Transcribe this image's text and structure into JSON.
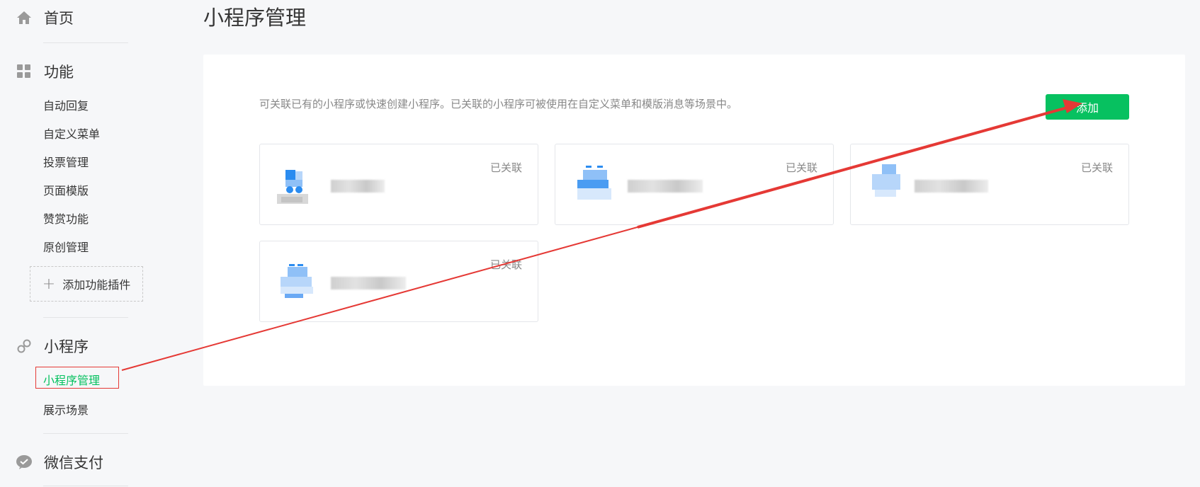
{
  "sidebar": {
    "home": {
      "label": "首页",
      "icon": "home-icon"
    },
    "features": {
      "label": "功能",
      "icon": "grid-icon",
      "items": [
        "自动回复",
        "自定义菜单",
        "投票管理",
        "页面模版",
        "赞赏功能",
        "原创管理"
      ],
      "add_plugin_label": "添加功能插件"
    },
    "miniprogram": {
      "label": "小程序",
      "icon": "link-icon",
      "items": [
        "小程序管理",
        "展示场景"
      ]
    },
    "wechat_pay": {
      "label": "微信支付",
      "icon": "wechat-pay-icon"
    }
  },
  "main": {
    "title": "小程序管理",
    "description": "可关联已有的小程序或快速创建小程序。已关联的小程序可被使用在自定义菜单和模版消息等场景中。",
    "add_button": "添加",
    "cards": [
      {
        "status": "已关联"
      },
      {
        "status": "已关联"
      },
      {
        "status": "已关联"
      },
      {
        "status": "已关联"
      }
    ]
  },
  "colors": {
    "accent": "#07c160",
    "annotation": "#e53935"
  }
}
